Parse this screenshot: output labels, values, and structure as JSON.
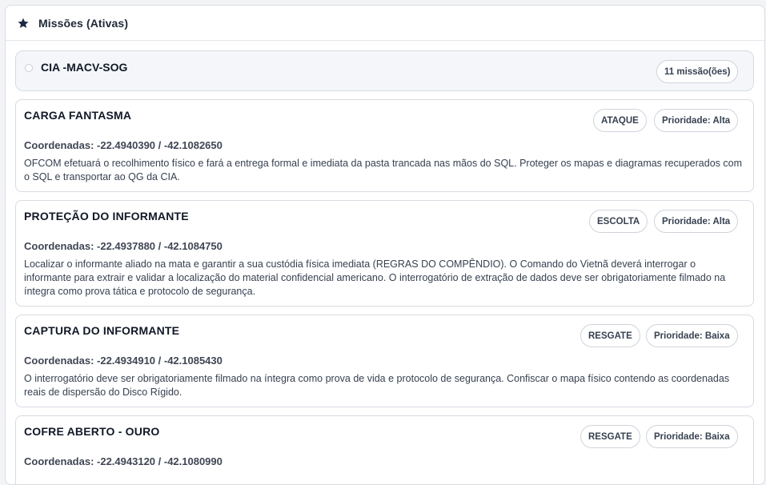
{
  "panel": {
    "title": "Missões (Ativas)"
  },
  "group": {
    "name": "CIA -MACV-SOG",
    "count_label": "11 missão(ões)"
  },
  "missions": [
    {
      "title": "CARGA FANTASMA",
      "type": "ATAQUE",
      "priority": "Prioridade: Alta",
      "coords": "Coordenadas: -22.4940390 / -42.1082650",
      "description": "OFCOM efetuará o recolhimento físico e fará a entrega formal e imediata da pasta trancada nas mãos do SQL. Proteger os mapas e diagramas recuperados com o SQL e transportar ao QG da CIA."
    },
    {
      "title": "PROTEÇÃO DO INFORMANTE",
      "type": "ESCOLTA",
      "priority": "Prioridade: Alta",
      "coords": "Coordenadas: -22.4937880 / -42.1084750",
      "description": "Localizar o informante aliado na mata e garantir a sua custódia física imediata (REGRAS DO COMPÊNDIO). O Comando do Vietnã deverá interrogar o informante para extrair e validar a localização do material confidencial americano. O interrogatório de extração de dados deve ser obrigatoriamente filmado na íntegra como prova tática e protocolo de segurança."
    },
    {
      "title": "CAPTURA DO INFORMANTE",
      "type": "RESGATE",
      "priority": "Prioridade: Baixa",
      "coords": "Coordenadas: -22.4934910 / -42.1085430",
      "description": "O interrogatório deve ser obrigatoriamente filmado na íntegra como prova de vida e protocolo de segurança. Confiscar o mapa físico contendo as coordenadas reais de dispersão do Disco Rígido."
    },
    {
      "title": "COFRE ABERTO - OURO",
      "type": "RESGATE",
      "priority": "Prioridade: Baixa",
      "coords": "Coordenadas: -22.4943120 / -42.1080990",
      "description": ""
    }
  ],
  "colors": {
    "accent_star": "#1e2a44",
    "card_border": "#d7dbe1",
    "group_bg": "#f4f6f9"
  }
}
